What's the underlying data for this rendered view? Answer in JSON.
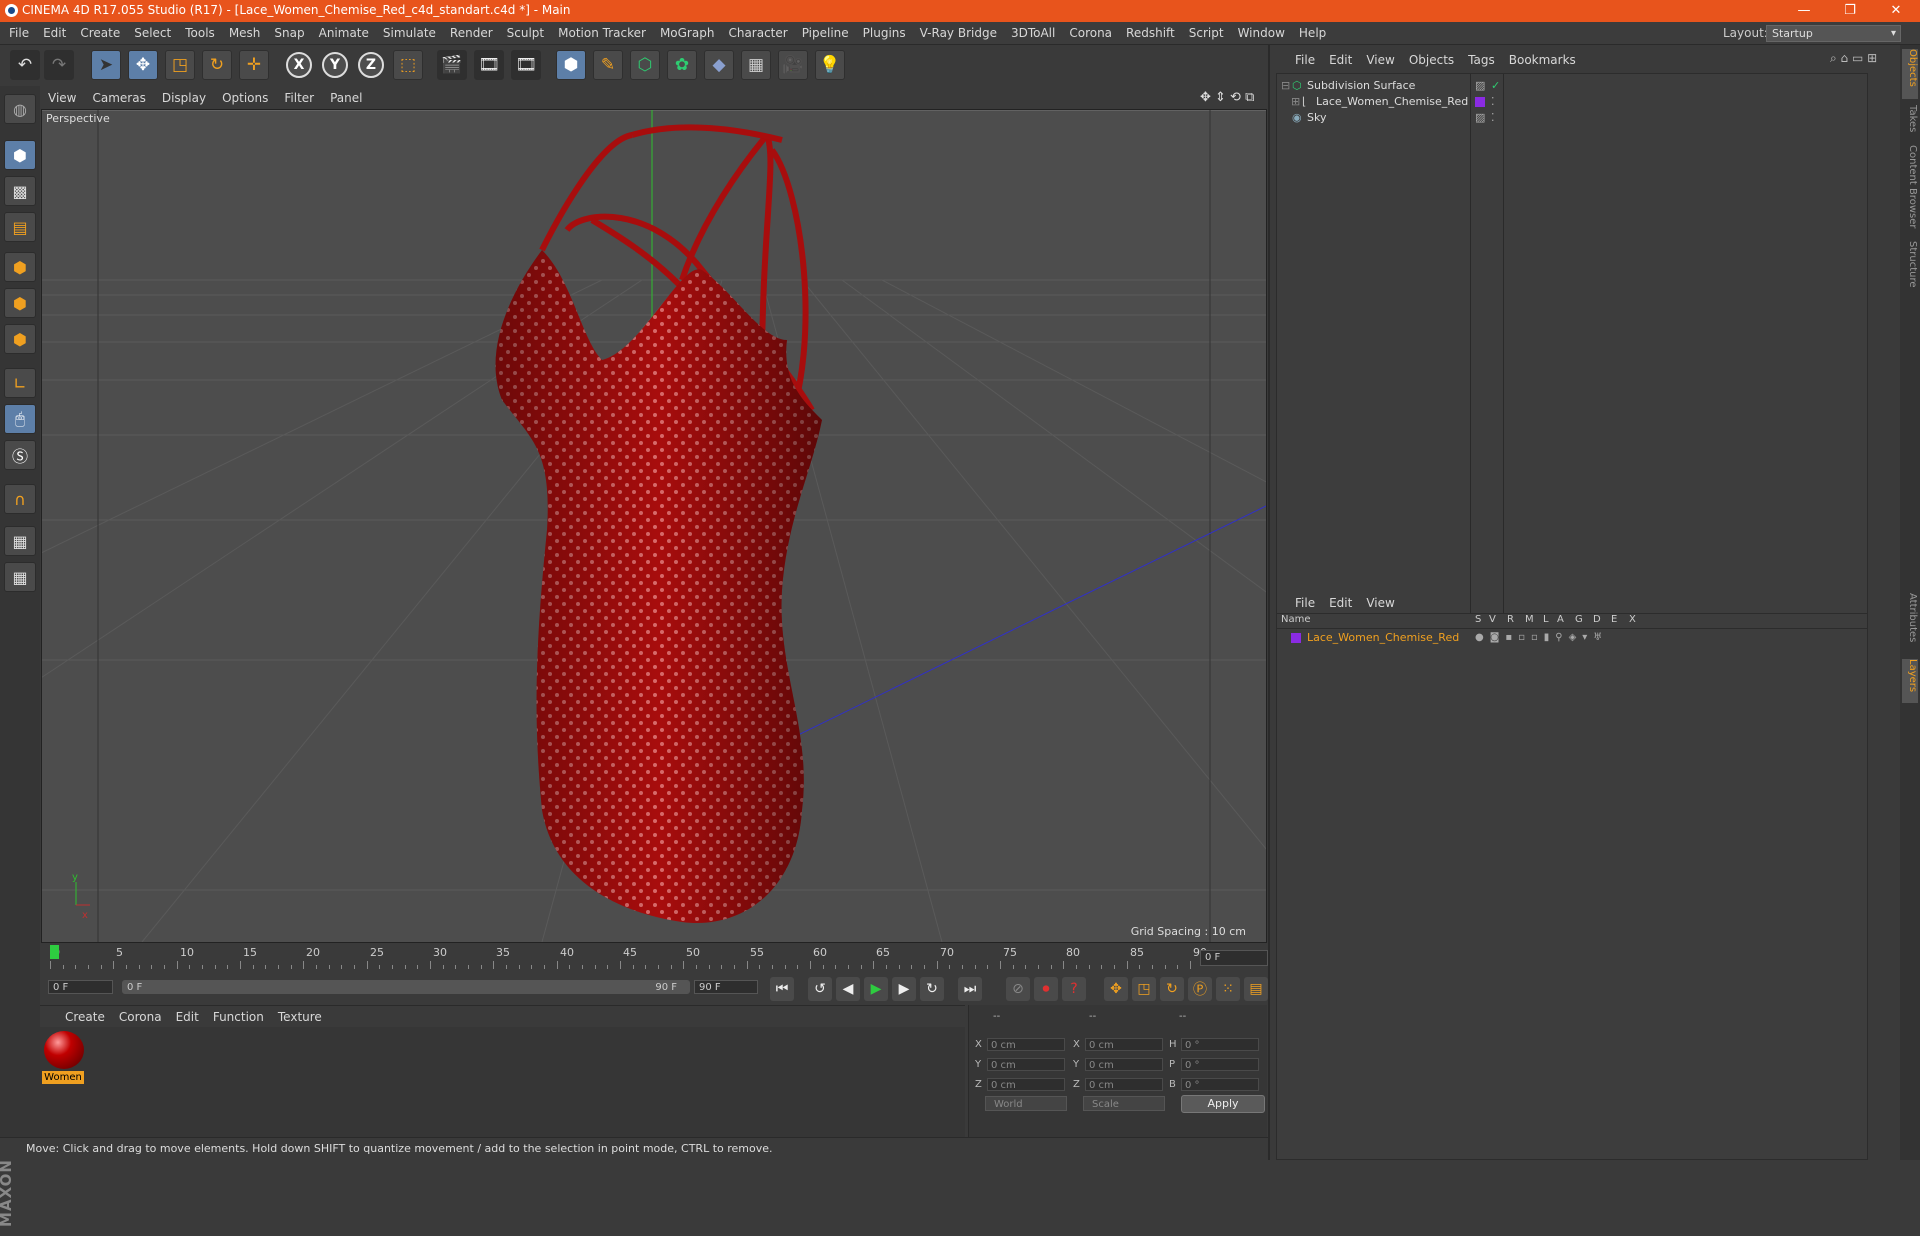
{
  "window": {
    "title": "CINEMA 4D R17.055 Studio (R17) - [Lace_Women_Chemise_Red_c4d_standart.c4d *] - Main",
    "minimize": "—",
    "maximize": "❐",
    "close": "✕"
  },
  "menubar": {
    "items": [
      "File",
      "Edit",
      "Create",
      "Select",
      "Tools",
      "Mesh",
      "Snap",
      "Animate",
      "Simulate",
      "Render",
      "Sculpt",
      "Motion Tracker",
      "MoGraph",
      "Character",
      "Pipeline",
      "Plugins",
      "V-Ray Bridge",
      "3DToAll",
      "Corona",
      "Redshift",
      "Script",
      "Window",
      "Help"
    ],
    "layout_label": "Layout:",
    "layout_value": "Startup"
  },
  "viewport": {
    "menu": [
      "View",
      "Cameras",
      "Display",
      "Options",
      "Filter",
      "Panel"
    ],
    "label": "Perspective",
    "grid_spacing": "Grid Spacing : 10 cm"
  },
  "timeline": {
    "labels": [
      "0",
      "5",
      "10",
      "15",
      "20",
      "25",
      "30",
      "35",
      "40",
      "45",
      "50",
      "55",
      "60",
      "65",
      "70",
      "75",
      "80",
      "85",
      "90"
    ],
    "current_frame": "0 F"
  },
  "transport": {
    "start_frame": "0 F",
    "range_start": "0 F",
    "range_end": "90 F",
    "end_frame": "90 F"
  },
  "materials": {
    "menu": [
      "Create",
      "Corona",
      "Edit",
      "Function",
      "Texture"
    ],
    "items": [
      {
        "name": "Women"
      }
    ]
  },
  "coordinates": {
    "headers": [
      "--",
      "--",
      "--"
    ],
    "rows": [
      {
        "a": "X",
        "av": "0 cm",
        "b": "X",
        "bv": "0 cm",
        "c": "H",
        "cv": "0 °"
      },
      {
        "a": "Y",
        "av": "0 cm",
        "b": "Y",
        "bv": "0 cm",
        "c": "P",
        "cv": "0 °"
      },
      {
        "a": "Z",
        "av": "0 cm",
        "b": "Z",
        "bv": "0 cm",
        "c": "B",
        "cv": "0 °"
      }
    ],
    "world": "World",
    "scale": "Scale",
    "apply": "Apply"
  },
  "status": "Move: Click and drag to move elements. Hold down SHIFT to quantize movement / add to the selection in point mode, CTRL to remove.",
  "object_manager": {
    "menu": [
      "File",
      "Edit",
      "View",
      "Objects",
      "Tags",
      "Bookmarks"
    ],
    "objects": [
      {
        "name": "Subdivision Surface"
      },
      {
        "name": "Lace_Women_Chemise_Red"
      },
      {
        "name": "Sky"
      }
    ]
  },
  "layer_manager": {
    "menu": [
      "File",
      "Edit",
      "View"
    ],
    "columns": [
      "Name",
      "S",
      "V",
      "R",
      "M",
      "L",
      "A",
      "G",
      "D",
      "E",
      "X"
    ],
    "layers": [
      {
        "name": "Lace_Women_Chemise_Red"
      }
    ]
  },
  "side_tabs": [
    "Objects",
    "Takes",
    "Content Browser",
    "Structure",
    "Attributes",
    "Layers"
  ],
  "colors": {
    "accent": "#e8541c",
    "selected": "#f0a020",
    "layer_color": "#8a2be2"
  }
}
